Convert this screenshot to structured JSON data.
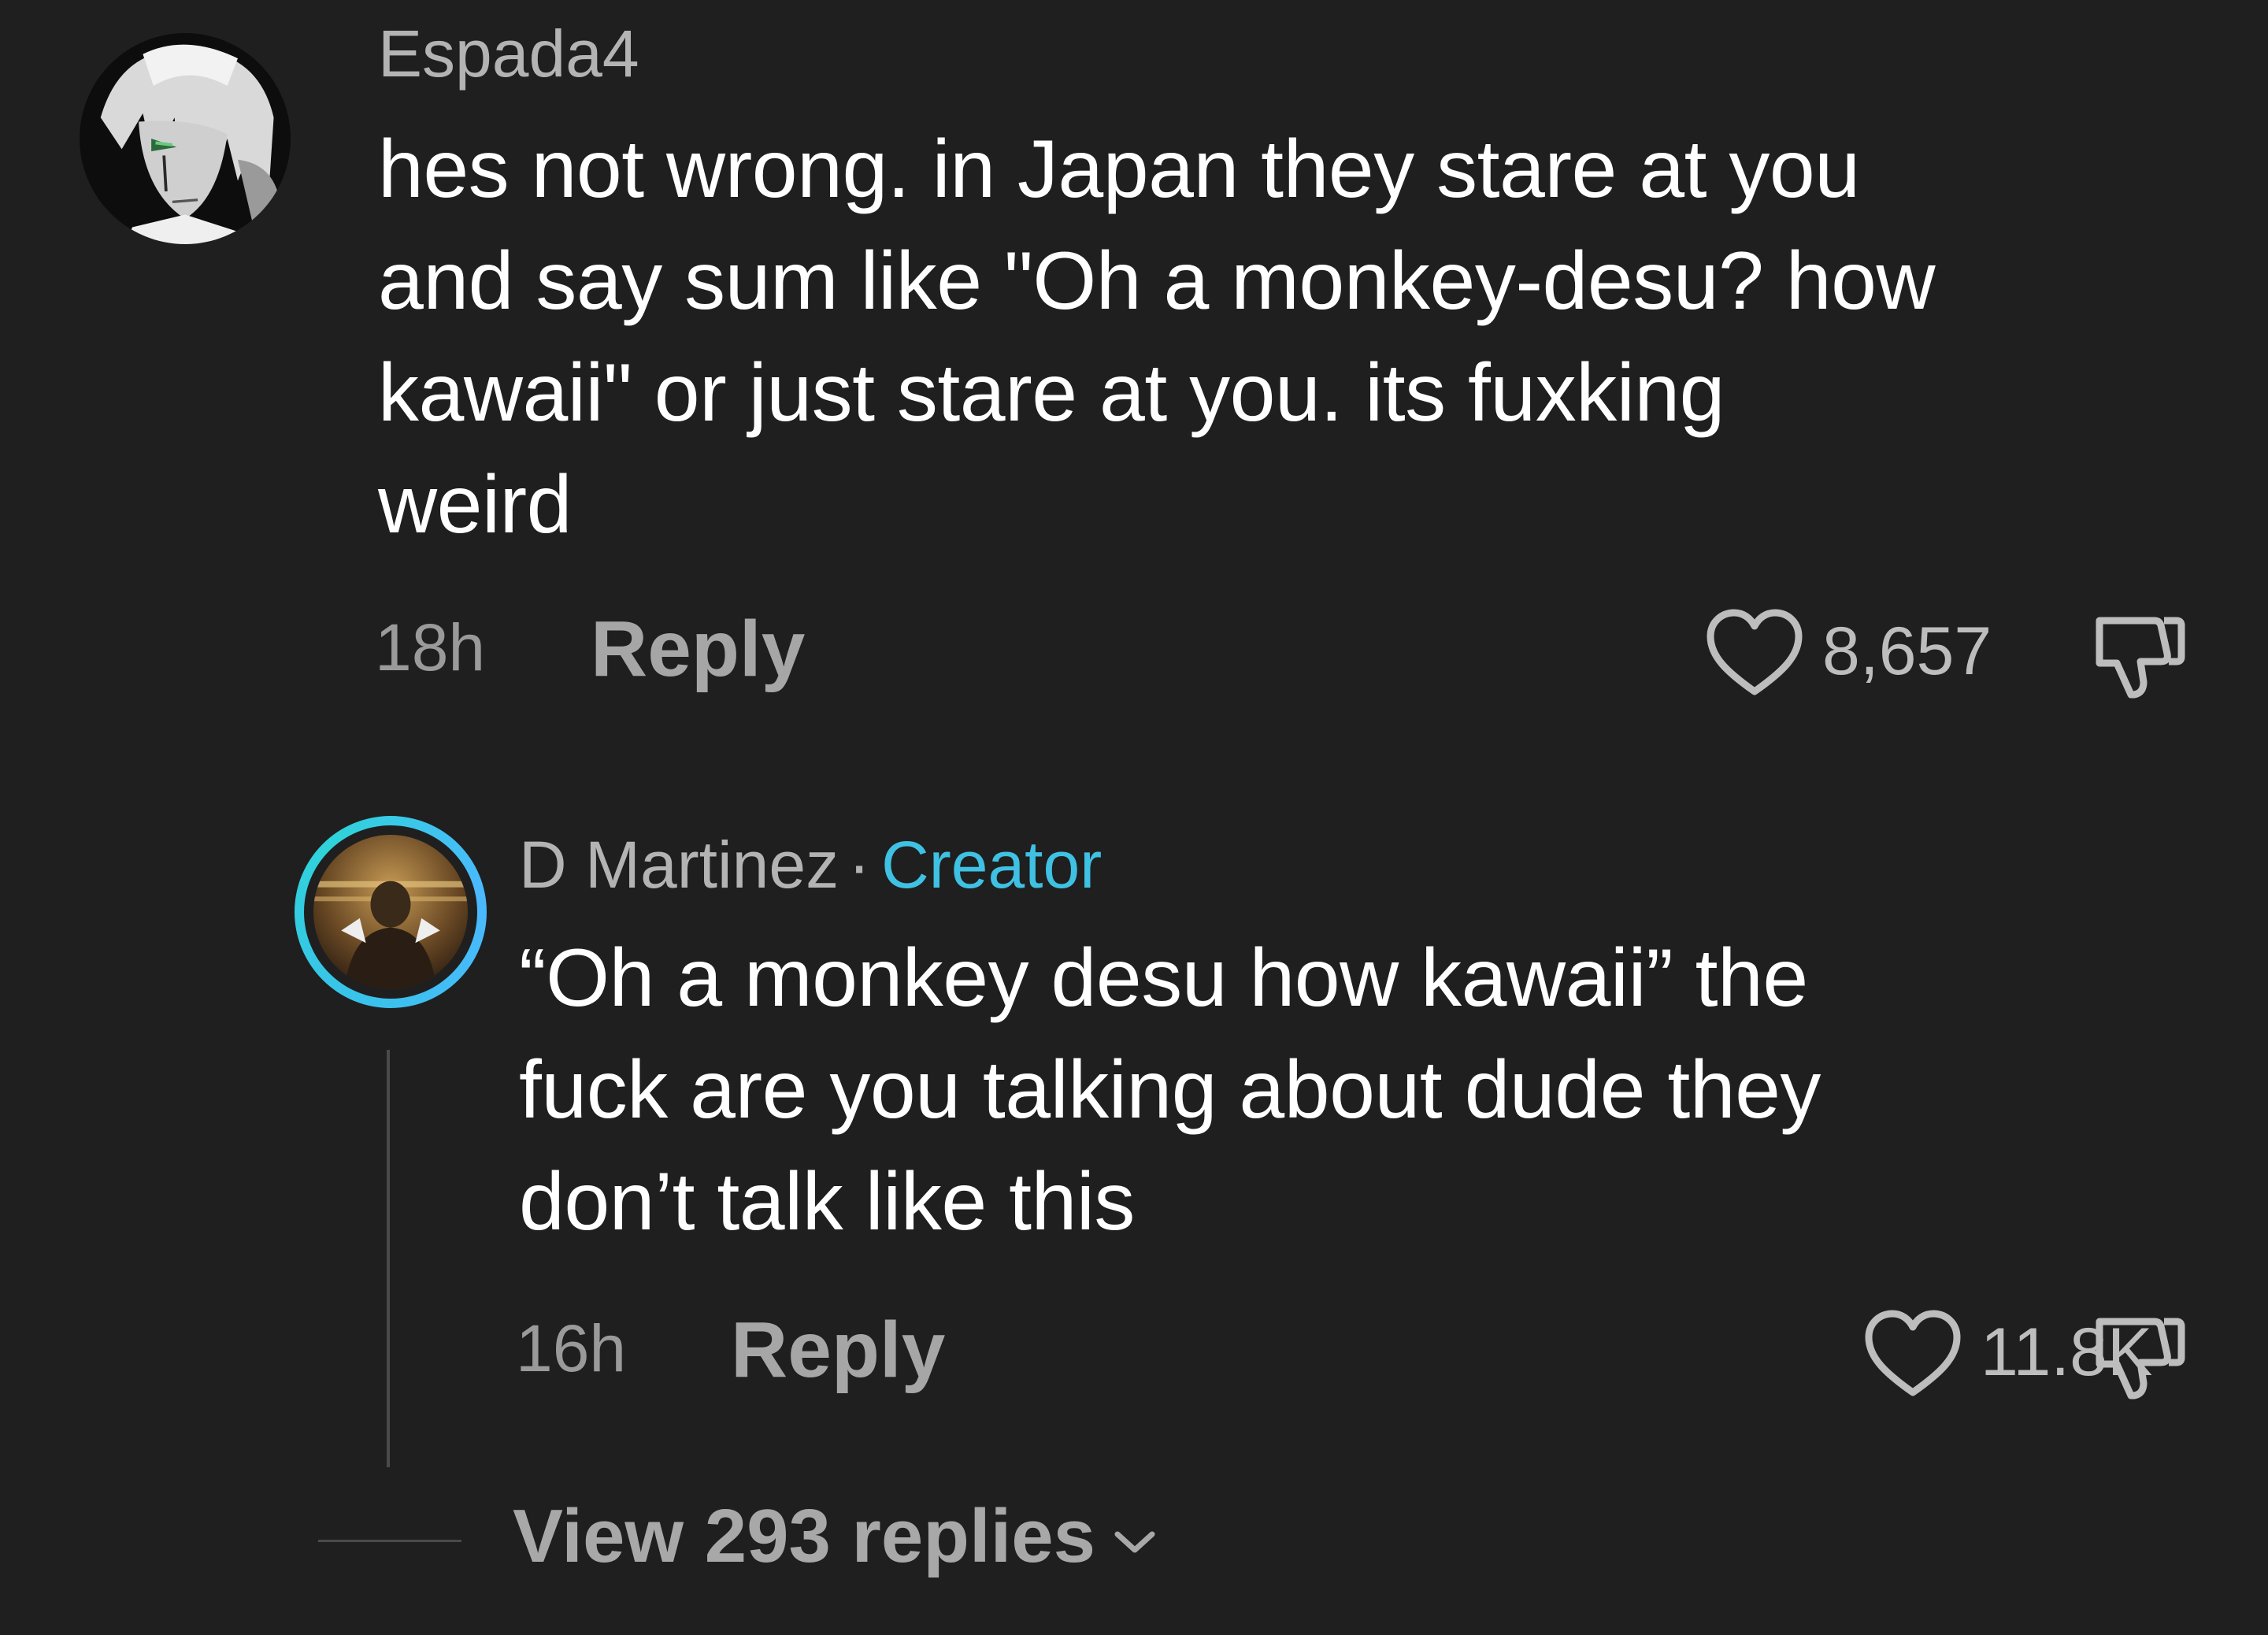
{
  "comments": [
    {
      "username": "Espada4",
      "text": "hes not wrong. in Japan they stare at you\nand say sum like \"Oh a monkey-desu? how\nkawaii\" or just stare at you. its fuxking\nweird",
      "time": "18h",
      "reply_label": "Reply",
      "likes": "8,657",
      "avatar_icon": "anime-character-avatar"
    },
    {
      "username": "D Martinez",
      "separator": "·",
      "badge": "Creator",
      "text": "“Oh a monkey desu how kawaii” the\nfuck are you talking about dude they\ndon’t talk like this",
      "time": "16h",
      "reply_label": "Reply",
      "likes": "11.8K",
      "avatar_icon": "creator-avatar"
    }
  ],
  "view_replies": "View 293 replies",
  "colors": {
    "background": "#1f1f1f",
    "text": "#ffffff",
    "muted": "#a6a6a6",
    "creator_badge": "#3fc1e3"
  },
  "icons": [
    "heart-icon",
    "dislike-icon",
    "chevron-down-icon"
  ]
}
